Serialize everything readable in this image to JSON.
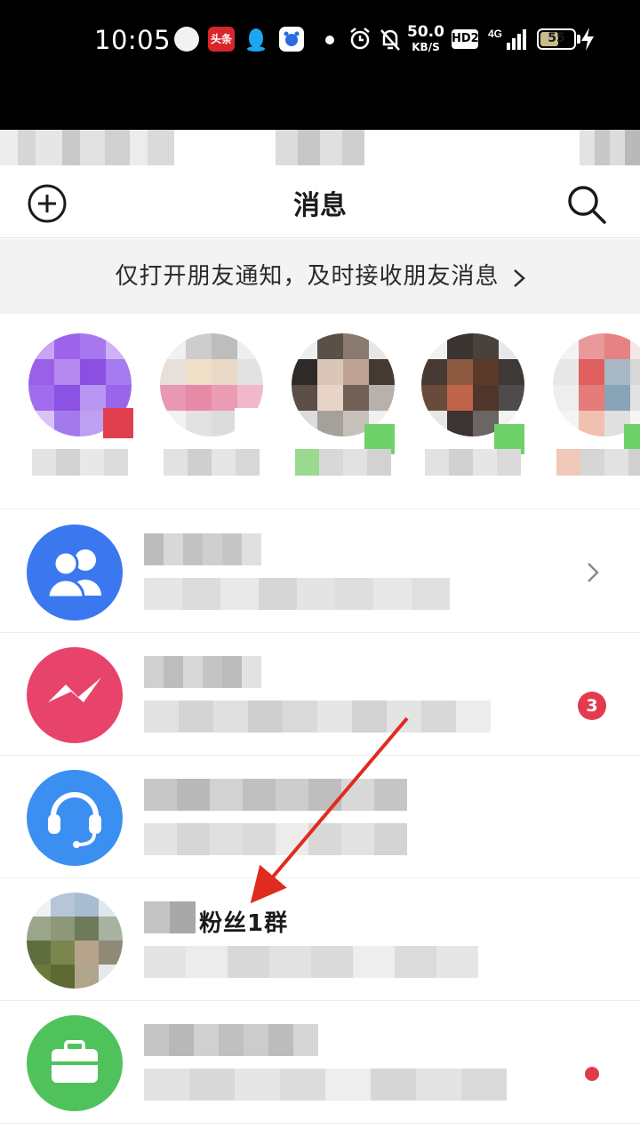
{
  "status_bar": {
    "time": "10:05",
    "app_badge_text": "头条",
    "net_speed_value": "50.0",
    "net_speed_unit": "KB/S",
    "hd_label": "HD2",
    "network_label": "4G",
    "battery_level": "55",
    "colors": {
      "background": "#000000",
      "foreground": "#ffffff"
    },
    "icons": [
      "robot-app-icon",
      "toutiao-app-icon",
      "qq-app-icon",
      "baidu-app-icon",
      "notification-dot-icon",
      "alarm-icon",
      "mute-bell-icon",
      "signal-icon",
      "battery-icon",
      "charging-bolt-icon"
    ]
  },
  "header": {
    "title": "消息",
    "left_icon": "add-circle-icon",
    "right_icon": "search-icon"
  },
  "notice": {
    "text": "仅打开朋友通知，及时接收朋友消息",
    "icon": "chevron-right-icon"
  },
  "friends": [
    {
      "status_color": "#e0404e"
    },
    {
      "status_color": "#ffffff"
    },
    {
      "status_color": "#6fd16a"
    },
    {
      "status_color": "#6fd16a"
    },
    {
      "status_color": "#6fd16a"
    }
  ],
  "conversations": [
    {
      "avatar_icon": "people-group-icon",
      "avatar_color": "#3b78f0",
      "trailing": "chevron-right-icon"
    },
    {
      "avatar_icon": "lightning-chat-icon",
      "avatar_color": "#e8436a",
      "badge_count": "3"
    },
    {
      "avatar_icon": "headset-icon",
      "avatar_color": "#3a8ff0"
    },
    {
      "avatar_icon": "group-photo-icon",
      "name_suffix": "粉丝1群"
    },
    {
      "avatar_icon": "briefcase-icon",
      "avatar_color": "#4fc25c",
      "trailing": "red-dot-icon"
    }
  ],
  "annotation": {
    "arrow_color": "#e02b20",
    "icon": "red-arrow-icon"
  },
  "colors": {
    "accent_red": "#e33b4e",
    "divider": "#ececec",
    "notice_bg": "#f3f3f3"
  }
}
